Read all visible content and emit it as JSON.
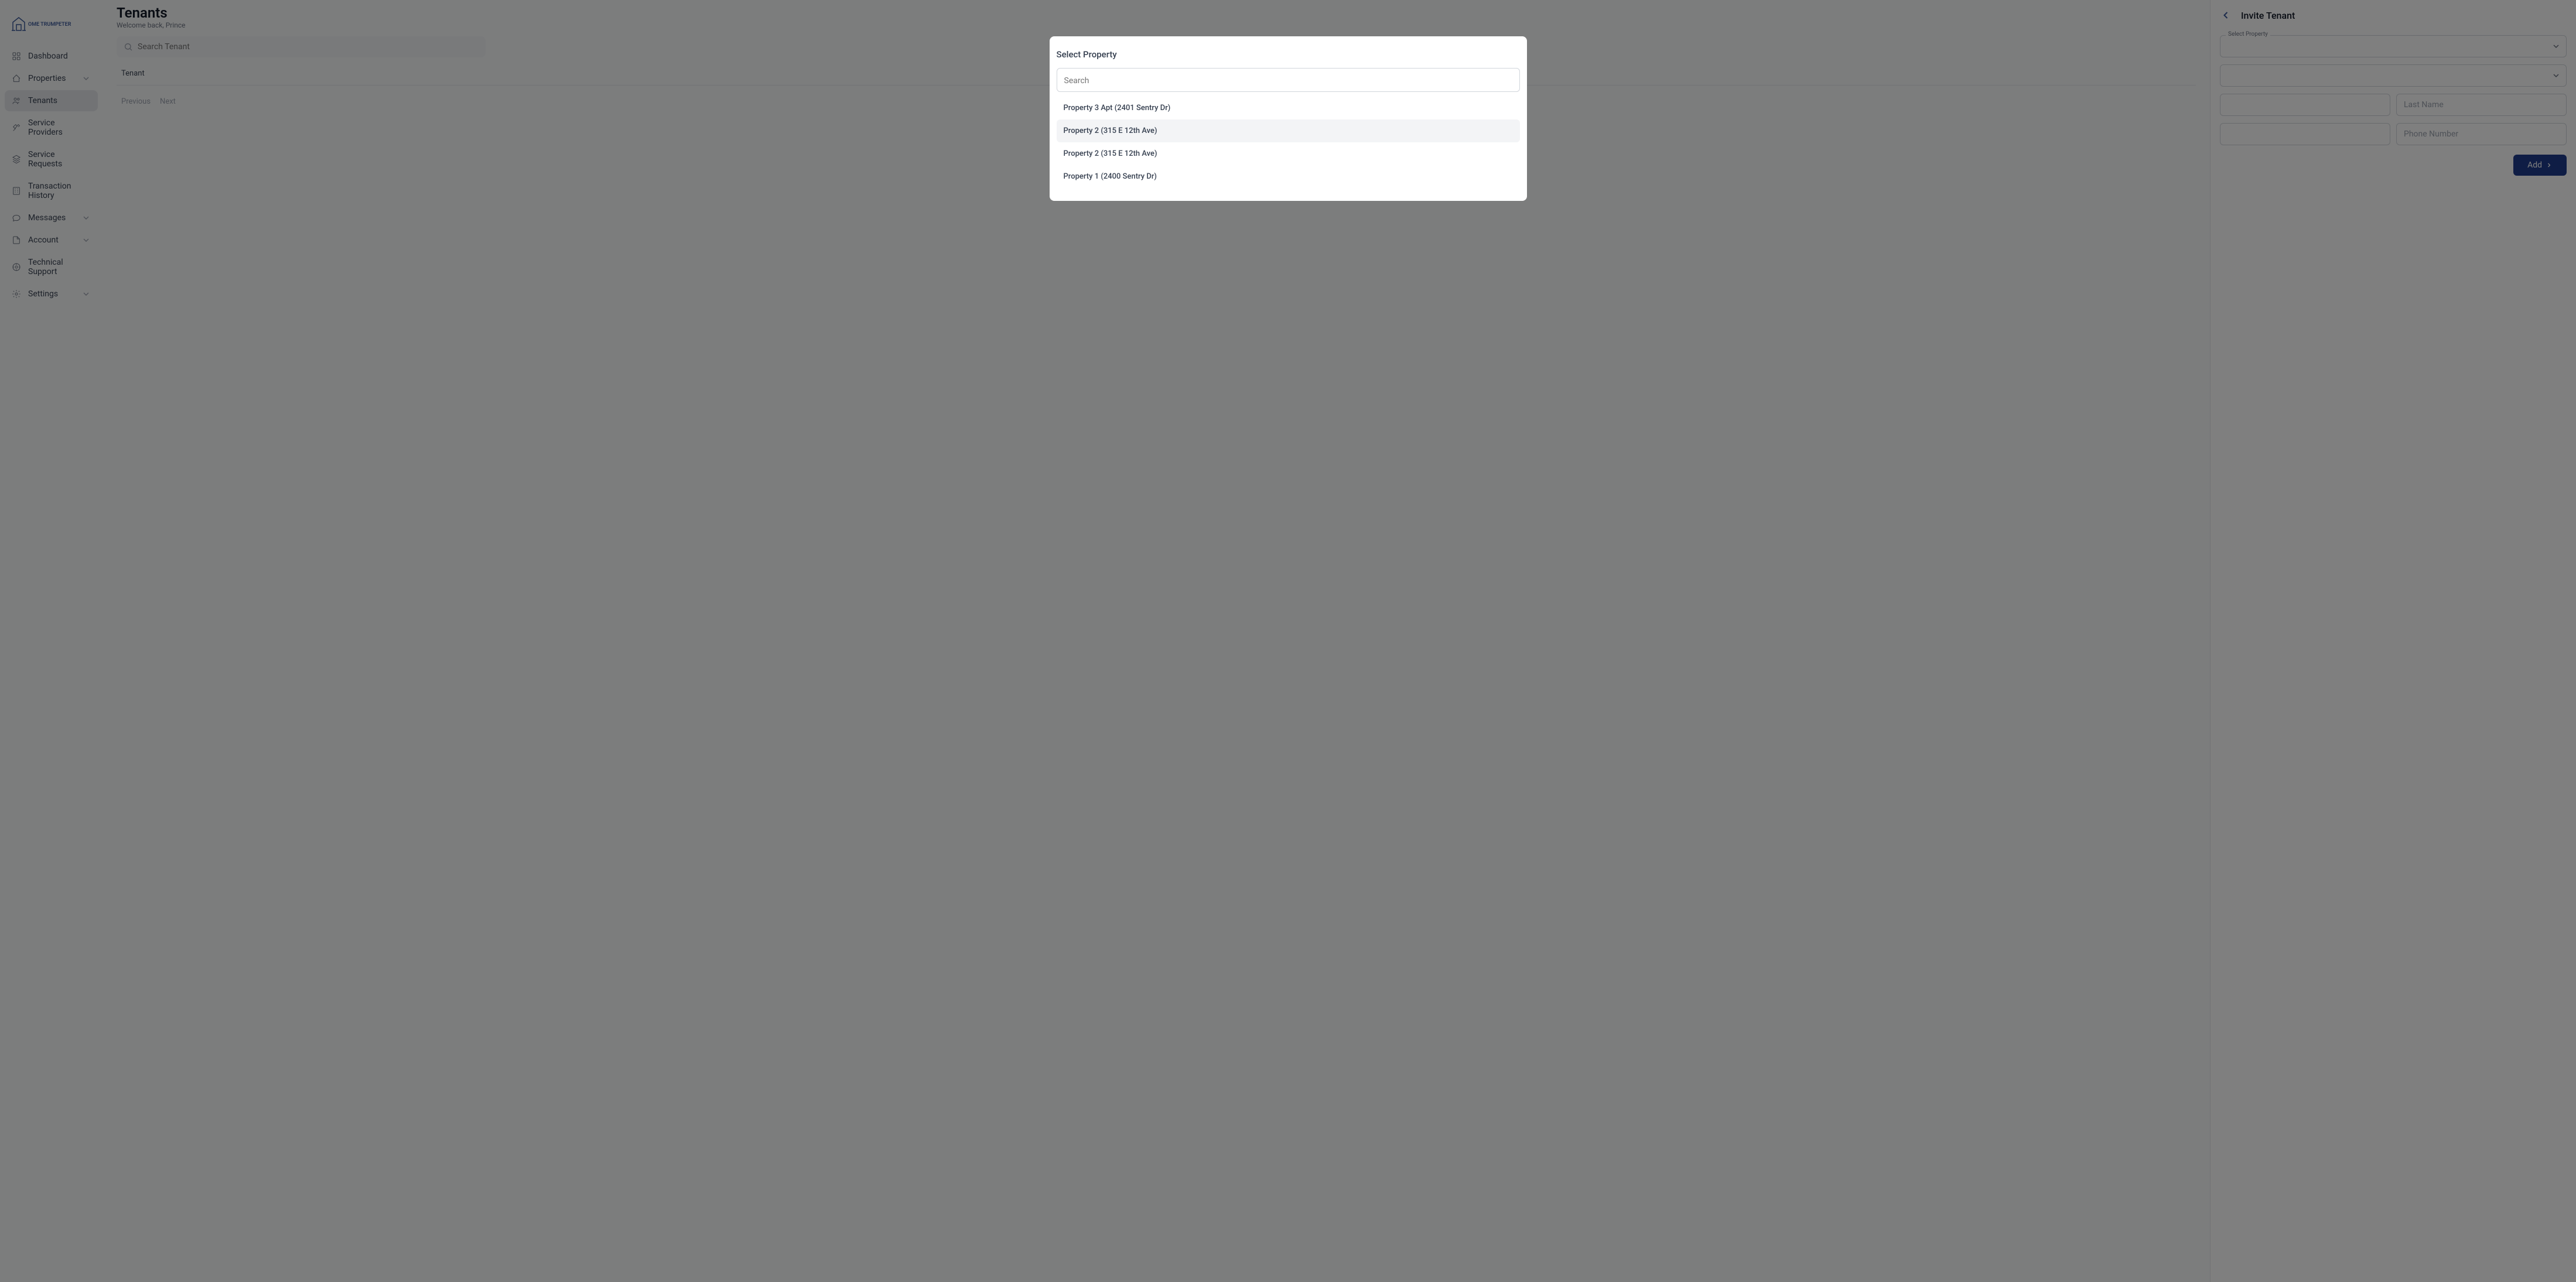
{
  "brand": "OME TRUMPETER",
  "sidebar": {
    "items": [
      {
        "label": "Dashboard",
        "icon": "dashboard-icon"
      },
      {
        "label": "Properties",
        "icon": "home-icon",
        "chevron": true
      },
      {
        "label": "Tenants",
        "icon": "users-icon",
        "active": true
      },
      {
        "label": "Service Providers",
        "icon": "tools-icon"
      },
      {
        "label": "Service Requests",
        "icon": "layers-icon"
      },
      {
        "label": "Transaction History",
        "icon": "building-icon"
      },
      {
        "label": "Messages",
        "icon": "message-icon",
        "chevron": true
      },
      {
        "label": "Account",
        "icon": "file-icon",
        "chevron": true
      },
      {
        "label": "Technical Support",
        "icon": "support-icon"
      },
      {
        "label": "Settings",
        "icon": "settings-icon",
        "chevron": true
      }
    ]
  },
  "main": {
    "title": "Tenants",
    "subtitle": "Welcome back, Prince",
    "search_placeholder": "Search Tenant",
    "table_header": "Tenant",
    "pagination": {
      "previous": "Previous",
      "next": "Next"
    }
  },
  "panel": {
    "title": "Invite Tenant",
    "select_property_label": "Select Property",
    "last_name_placeholder": "Last Name",
    "phone_placeholder": "Phone Number",
    "add_button": "Add"
  },
  "modal": {
    "title": "Select Property",
    "search_placeholder": "Search",
    "properties": [
      "Property 3 Apt (2401 Sentry Dr)",
      "Property 2 (315 E 12th Ave)",
      "Property 2 (315 E 12th Ave)",
      "Property 1 (2400 Sentry Dr)"
    ]
  }
}
